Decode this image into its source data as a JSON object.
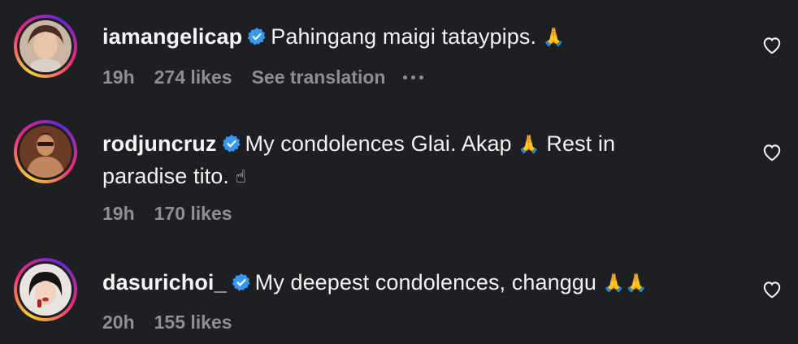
{
  "comments": [
    {
      "username": "iamangelicap",
      "text": "Pahingang maigi tataypips.",
      "emoji": "🙏",
      "time": "19h",
      "likes": "274 likes",
      "translate": "See translation",
      "more": "more-options"
    },
    {
      "username": "rodjuncruz",
      "text1": "My condolences Glai. Akap",
      "emoji1": "🙏",
      "text2": "Rest in",
      "text3": "paradise tito.",
      "emoji2": "☝",
      "time": "19h",
      "likes": "170 likes"
    },
    {
      "username": "dasurichoi_",
      "text": "My deepest condolences, changgu",
      "emoji": "🙏🙏",
      "time": "20h",
      "likes": "155 likes"
    }
  ],
  "colors": {
    "background": "#1e1f22",
    "verified": "#3897f0",
    "muted": "#8e8e93"
  },
  "icons": [
    "verified-badge-icon",
    "heart-icon",
    "more-dots-icon"
  ]
}
